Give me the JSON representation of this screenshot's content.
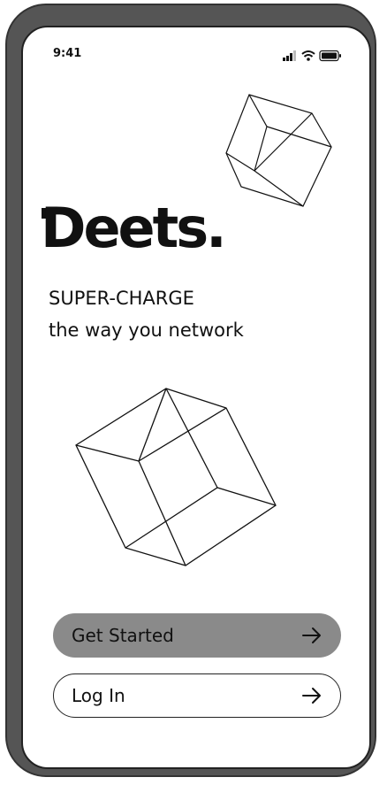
{
  "status_bar": {
    "time": "9:41",
    "signal_icon": "cellular-signal-icon",
    "wifi_icon": "wifi-icon",
    "battery_icon": "battery-icon"
  },
  "brand": {
    "logo_text": "Deets."
  },
  "tagline": {
    "line1": "SUPER-CHARGE",
    "line2": "the way you network"
  },
  "actions": {
    "get_started_label": "Get Started",
    "login_label": "Log In",
    "arrow_icon": "arrow-right-icon"
  },
  "colors": {
    "frame": "#555555",
    "primary_button": "#8a8a8a",
    "text": "#111111"
  }
}
